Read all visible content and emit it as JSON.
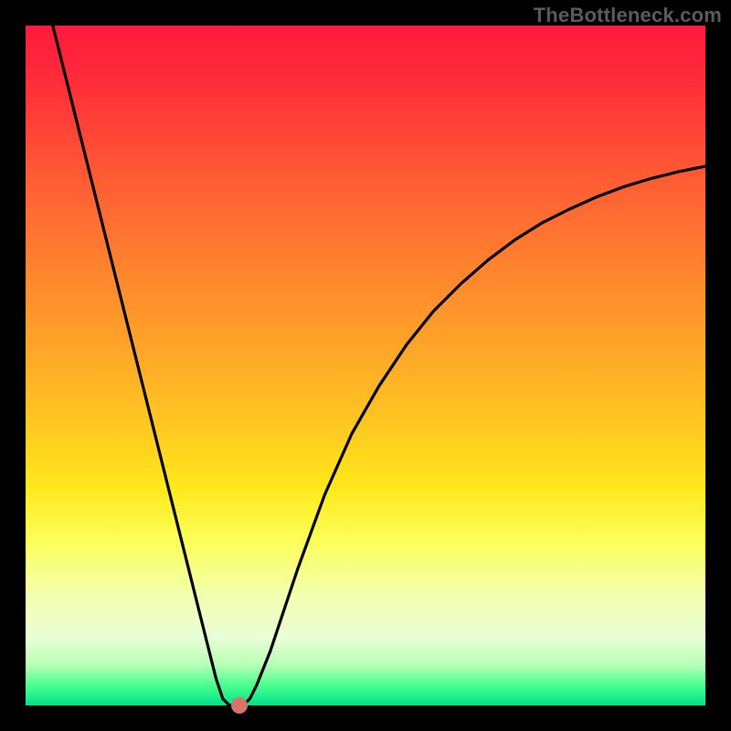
{
  "watermark": "TheBottleneck.com",
  "chart_data": {
    "type": "line",
    "title": "",
    "xlabel": "",
    "ylabel": "",
    "xlim": [
      0,
      100
    ],
    "ylim": [
      0,
      100
    ],
    "series": [
      {
        "name": "curve",
        "x": [
          4,
          6,
          8,
          10,
          12,
          14,
          16,
          18,
          20,
          22,
          24,
          26,
          27,
          28,
          29,
          30,
          31,
          32,
          33,
          34,
          36,
          38,
          40,
          44,
          48,
          52,
          56,
          60,
          64,
          68,
          72,
          76,
          80,
          84,
          88,
          92,
          96,
          100
        ],
        "y": [
          100,
          92,
          84,
          76,
          68,
          60,
          52,
          44,
          36,
          28,
          20,
          12,
          8,
          4,
          1,
          0,
          0,
          0,
          1,
          3,
          8,
          14,
          20,
          31,
          40,
          47,
          53,
          58,
          62,
          65.5,
          68.5,
          71,
          73,
          74.8,
          76.3,
          77.5,
          78.5,
          79.3
        ]
      }
    ],
    "marker": {
      "x": 31.5,
      "y": 0
    },
    "background_gradient": {
      "top_color": "#ff1a3c",
      "bottom_color": "#00e28a"
    }
  }
}
